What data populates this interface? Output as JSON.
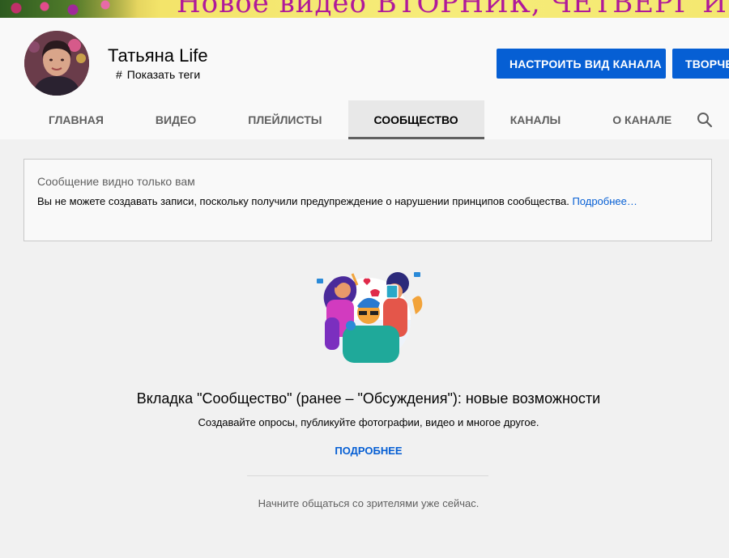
{
  "banner": {
    "text": "Новое видео ВТОРНИК, ЧЕТВЕРГ И СУББОТА"
  },
  "channel": {
    "name": "Татьяна Life",
    "tags_icon": "#",
    "tags_label": "Показать теги"
  },
  "buttons": {
    "customize": "НАСТРОИТЬ ВИД КАНАЛА",
    "studio": "ТВОРЧЕСКАЯ СТУДИЯ"
  },
  "tabs": [
    {
      "label": "ГЛАВНАЯ"
    },
    {
      "label": "ВИДЕО"
    },
    {
      "label": "ПЛЕЙЛИСТЫ"
    },
    {
      "label": "СООБЩЕСТВО",
      "active": true
    },
    {
      "label": "КАНАЛЫ"
    },
    {
      "label": "О КАНАЛЕ"
    }
  ],
  "search_icon": "search-icon",
  "notice": {
    "title": "Сообщение видно только вам",
    "body": "Вы не можете создавать записи, поскольку получили предупреждение о нарушении принципов сообщества.",
    "link": "Подробнее…"
  },
  "promo": {
    "title": "Вкладка \"Сообщество\" (ранее – \"Обсуждения\"): новые возможности",
    "subtitle": "Создавайте опросы, публикуйте фотографии, видео и многое другое.",
    "link": "ПОДРОБНЕЕ",
    "start_text": "Начните общаться со зрителями уже сейчас."
  },
  "colors": {
    "accent": "#065fd4",
    "page_bg": "#f1f1f1",
    "header_bg": "#f9f9f9"
  }
}
